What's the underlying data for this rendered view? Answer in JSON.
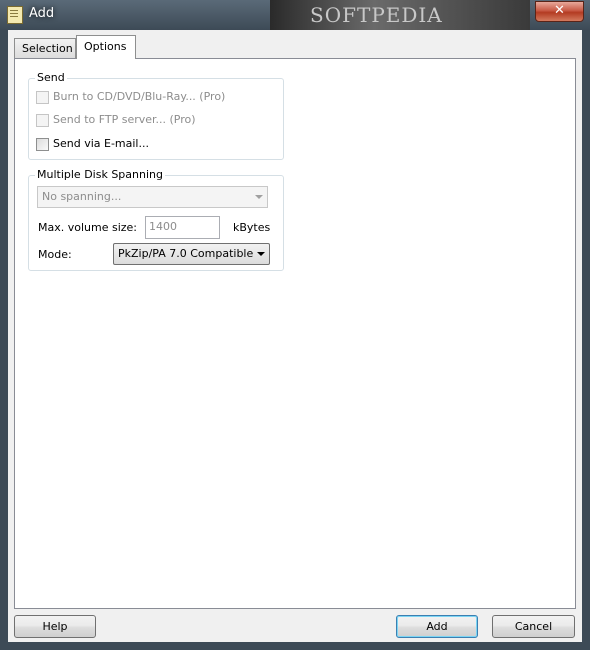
{
  "window": {
    "title": "Add",
    "close_label": "✕",
    "watermark": "SOFTPEDIA"
  },
  "tabs": [
    {
      "label": "Selection",
      "active": false
    },
    {
      "label": "Options",
      "active": true
    }
  ],
  "send_group": {
    "legend": "Send",
    "options": [
      {
        "label": "Burn to CD/DVD/Blu-Ray... (Pro)",
        "enabled": false,
        "checked": false
      },
      {
        "label": "Send to FTP server... (Pro)",
        "enabled": false,
        "checked": false
      },
      {
        "label": "Send via E-mail...",
        "enabled": true,
        "checked": false
      }
    ]
  },
  "spanning_group": {
    "legend": "Multiple Disk Spanning",
    "spanning_select": "No spanning...",
    "max_volume_label": "Max. volume size:",
    "max_volume_value": "1400",
    "max_volume_unit": "kBytes",
    "mode_label": "Mode:",
    "mode_value": "PkZip/PA 7.0 Compatible"
  },
  "buttons": {
    "help": "Help",
    "add": "Add",
    "cancel": "Cancel"
  }
}
